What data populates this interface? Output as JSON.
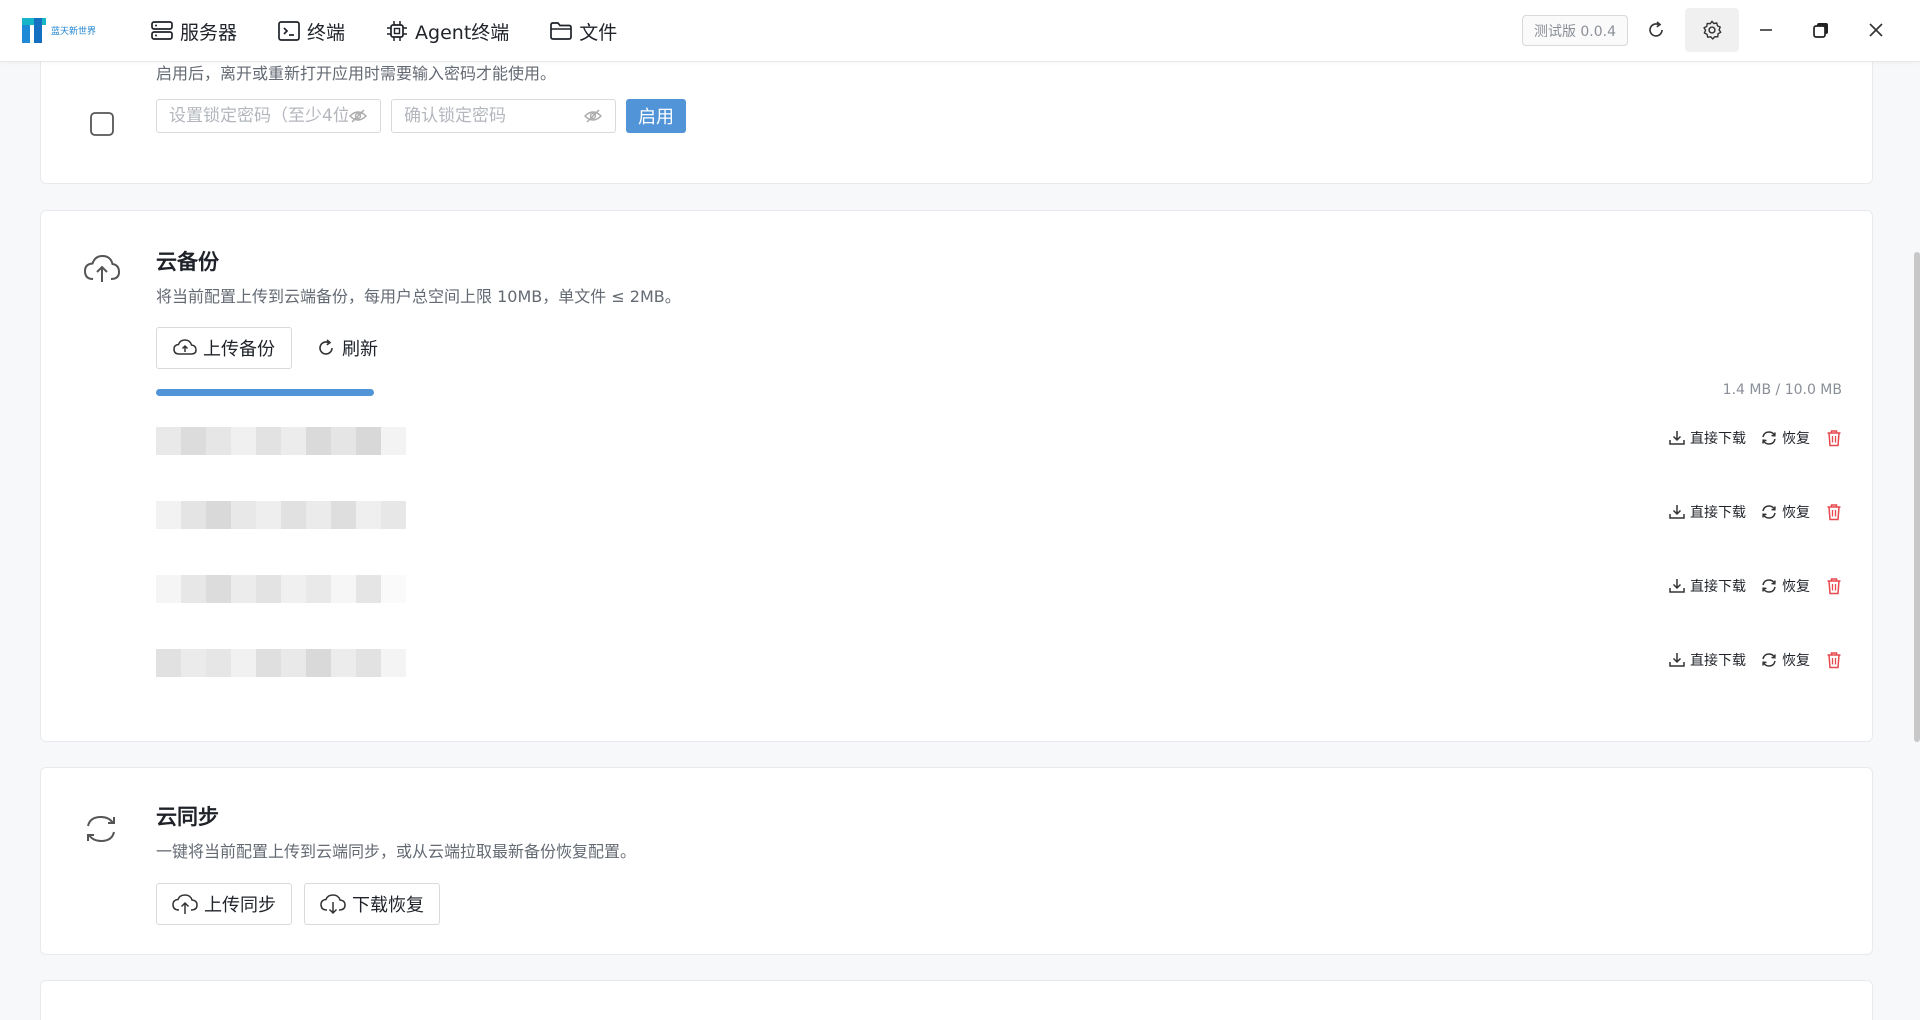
{
  "app": {
    "logo_text": "蓝天新世界",
    "nav": [
      {
        "label": "服务器",
        "icon": "server-icon"
      },
      {
        "label": "终端",
        "icon": "terminal-icon"
      },
      {
        "label": "Agent终端",
        "icon": "chip-icon"
      },
      {
        "label": "文件",
        "icon": "folder-icon"
      }
    ],
    "version": "测试版 0.0.4"
  },
  "lock": {
    "desc": "启用后，离开或重新打开应用时需要输入密码才能使用。",
    "password_placeholder": "设置锁定密码（至少4位）",
    "confirm_placeholder": "确认锁定密码",
    "enable_label": "启用"
  },
  "cloud_backup": {
    "title": "云备份",
    "desc": "将当前配置上传到云端备份，每用户总空间上限 10MB，单文件 ≤ 2MB。",
    "upload_label": "上传备份",
    "refresh_label": "刷新",
    "usage_text": "1.4 MB / 10.0 MB",
    "usage_fraction": 0.14,
    "download_label": "直接下载",
    "restore_label": "恢复",
    "rows": 4
  },
  "cloud_sync": {
    "title": "云同步",
    "desc": "一键将当前配置上传到云端同步，或从云端拉取最新备份恢复配置。",
    "upload_label": "上传同步",
    "download_label": "下载恢复"
  },
  "colors": {
    "accent": "#5294d8",
    "danger": "#e5484d"
  }
}
